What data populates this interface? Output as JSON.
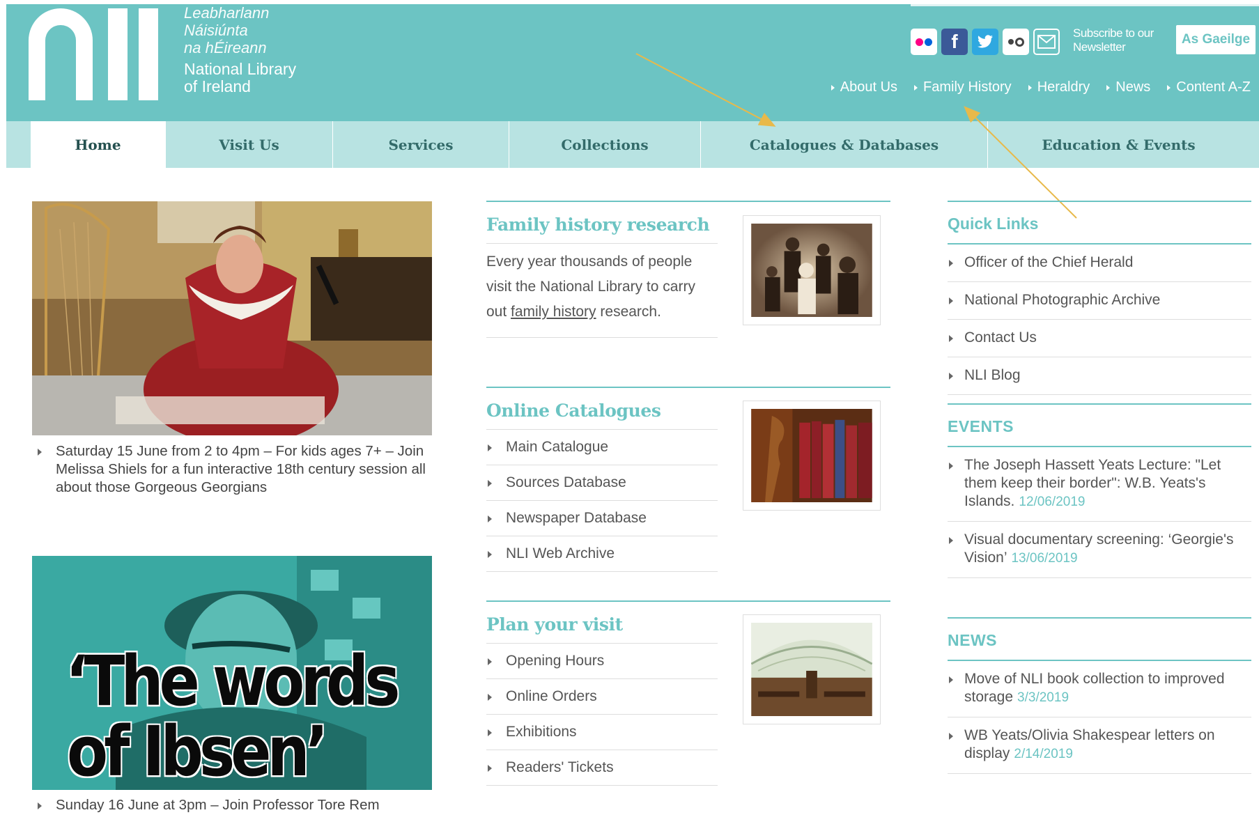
{
  "header": {
    "logo_irish": [
      "Leabharlann",
      "Náisiúnta",
      "na hÉireann"
    ],
    "logo_english": [
      "National Library",
      "of Ireland"
    ],
    "subscribe": [
      "Subscribe to our",
      "Newsletter"
    ],
    "language_button": "As Gaeilge",
    "util_nav": [
      "About Us",
      "Family History",
      "Heraldry",
      "News",
      "Content A-Z"
    ],
    "social_icons": [
      "flickr-icon",
      "facebook-icon",
      "twitter-icon",
      "flickr-alt-icon",
      "mail-icon"
    ]
  },
  "main_nav": [
    "Home",
    "Visit Us",
    "Services",
    "Collections",
    "Catalogues & Databases",
    "Education & Events"
  ],
  "features": [
    {
      "image_alt": "Woman in red 18th century dress writing with quill",
      "caption": "Saturday 15 June from 2 to 4pm – For kids ages 7+ – Join Melissa Shiels for a fun interactive 18th century session all about those Gorgeous Georgians"
    },
    {
      "image_text": [
        "‘The words",
        "of Ibsen’"
      ],
      "caption": "Sunday 16 June at 3pm – Join Professor Tore Rem"
    }
  ],
  "family_history": {
    "title": "Family history research",
    "text_before": "Every year thousands of people visit the National Library to carry out ",
    "link": "family history",
    "text_after": " research."
  },
  "online_catalogues": {
    "title": "Online Catalogues",
    "items": [
      "Main Catalogue",
      "Sources Database",
      "Newspaper Database",
      "NLI Web Archive"
    ]
  },
  "plan_visit": {
    "title": "Plan your visit",
    "items": [
      "Opening Hours",
      "Online Orders",
      "Exhibitions",
      "Readers' Tickets"
    ]
  },
  "quick_links": {
    "title": "Quick Links",
    "items": [
      "Officer of the Chief Herald",
      "National Photographic Archive",
      "Contact Us",
      "NLI Blog"
    ]
  },
  "events": {
    "title": "EVENTS",
    "items": [
      {
        "text": "The Joseph Hassett Yeats Lecture: \"Let them keep their border\": W.B. Yeats's Islands.",
        "date": "12/06/2019"
      },
      {
        "text": "Visual documentary screening: ‘Georgie's Vision’",
        "date": "13/06/2019"
      }
    ]
  },
  "news": {
    "title": "NEWS",
    "items": [
      {
        "text": "Move of NLI book collection to improved storage",
        "date": "3/3/2019"
      },
      {
        "text": "WB Yeats/Olivia Shakespear letters on display",
        "date": "2/14/2019"
      }
    ]
  },
  "colors": {
    "teal": "#6cc4c3",
    "nav_bg": "#b8e3e2",
    "arrow": "#e8b94a"
  }
}
